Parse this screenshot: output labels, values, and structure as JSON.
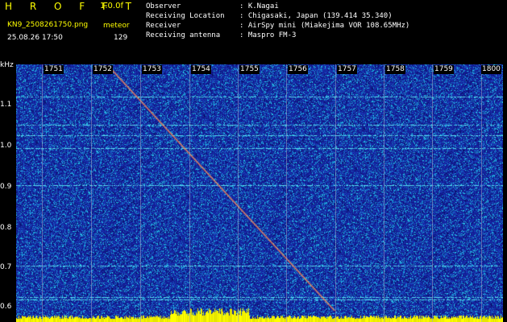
{
  "header": {
    "app_name": "H R O F F T",
    "version": "1.0.0f",
    "filename": "KN9_2508261750.png",
    "mode": "meteor",
    "datetime": "25.08.26 17:50",
    "count": "129",
    "info": [
      {
        "label": "Observer",
        "value": ": K.Nagai"
      },
      {
        "label": "Receiving Location",
        "value": ": Chigasaki, Japan (139.414 35.340)"
      },
      {
        "label": "Receiver",
        "value": ": AirSpy mini (Miakejima VOR 108.65MHz)"
      },
      {
        "label": "Receiving antenna",
        "value": ": Maspro FM-3"
      }
    ]
  },
  "axes": {
    "y_unit": "kHz",
    "x_ticks": [
      "1751",
      "1752",
      "1753",
      "1754",
      "1755",
      "1756",
      "1757",
      "1758",
      "1759",
      "1800"
    ],
    "y_ticks": [
      "1.1",
      "1.0",
      "0.9",
      "0.8",
      "0.7",
      "0.6"
    ]
  },
  "colors": {
    "background": "#000000",
    "noise_blue": "#1a2fa8",
    "noise_cyan": "#1fd6e8",
    "accent_yellow": "#ffff00",
    "text": "#ffffff"
  }
}
